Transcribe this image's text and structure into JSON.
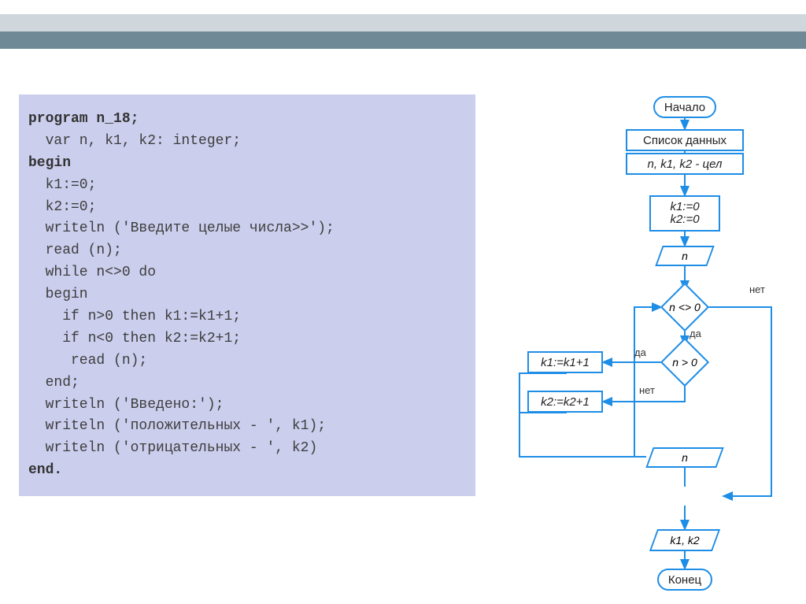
{
  "code": {
    "l1": "program n_18;",
    "l2": "  var n, k1, k2: integer;",
    "l3": "begin",
    "l4": "  k1:=0;",
    "l5": "  k2:=0;",
    "l6": "  writeln ('Введите целые числа>>');",
    "l7": "  read (n);",
    "l8": "  while n<>0 do",
    "l9": "  begin",
    "l10": "    if n>0 then k1:=k1+1;",
    "l11": "    if n<0 then k2:=k2+1;",
    "l12": "     read (n);",
    "l13": "  end;",
    "l14": "  writeln ('Введено:');",
    "l15": "  writeln ('положительных - ', k1);",
    "l16": "  writeln ('отрицательных - ', k2)",
    "l17": "end."
  },
  "flow": {
    "start": "Начало",
    "datalist": "Список данных",
    "decl": "n, k1, k2 - цел",
    "init1": "k1:=0",
    "init2": "k2:=0",
    "input_n": "n",
    "cond1": "n <> 0",
    "cond2": "n > 0",
    "assign1": "k1:=k1+1",
    "assign2": "k2:=k2+1",
    "input_n2": "n",
    "output": "k1, k2",
    "end": "Конец",
    "yes": "да",
    "no": "нет"
  }
}
